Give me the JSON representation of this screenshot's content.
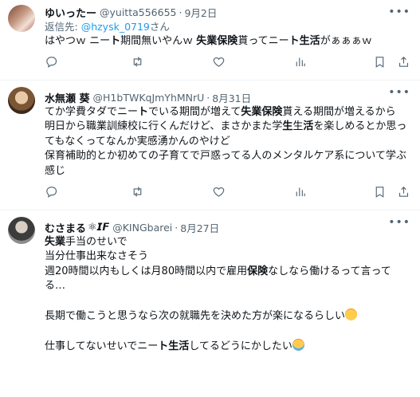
{
  "tweets": [
    {
      "name": "ゆいったー",
      "handle": "@yuitta556655",
      "dot": "·",
      "date": "9月2日",
      "reply_prefix": "返信先: ",
      "reply_to": "@hzysk_0719",
      "reply_suffix": "さん",
      "segments": [
        {
          "t": "はやつｗ ニー",
          "b": false
        },
        {
          "t": "ト",
          "b": true
        },
        {
          "t": "期間無いやんｗ ",
          "b": false
        },
        {
          "t": "失業保険",
          "b": true
        },
        {
          "t": "貰ってニー",
          "b": false
        },
        {
          "t": "ト生活",
          "b": true
        },
        {
          "t": "がぁぁぁｗ",
          "b": false
        }
      ]
    },
    {
      "name": "水無瀬 葵",
      "handle": "@H1bTWKqJmYhMNrU",
      "dot": "·",
      "date": "8月31日",
      "segments": [
        {
          "t": "てか学費タダでニー",
          "b": false
        },
        {
          "t": "ト",
          "b": true
        },
        {
          "t": "でいる期間が増えて",
          "b": false
        },
        {
          "t": "失業保険",
          "b": true
        },
        {
          "t": "貰える期間が増えるから\n明日から職業訓練校に行くんだけど、まさかまた学",
          "b": false
        },
        {
          "t": "生",
          "b": true
        },
        {
          "t": "生",
          "b": false
        },
        {
          "t": "活",
          "b": true
        },
        {
          "t": "を楽しめるとか思ってもなくってなんか実感湧かんのやけど\n保育補助的とか初めての子育てで戸惑ってる人のメンタルケア系について学ぶ感じ",
          "b": false
        }
      ]
    },
    {
      "name": "むさまる",
      "name_suffix": "⚛𝙄𝙁",
      "handle": "@KINGbarei",
      "dot": "·",
      "date": "8月27日",
      "segments": [
        {
          "t": "失業",
          "b": true
        },
        {
          "t": "手当のせいで\n当分仕事出来なさそう\n週20時間以内もしくは月80時間以内で雇用",
          "b": false
        },
        {
          "t": "保険",
          "b": true
        },
        {
          "t": "なしなら働けるって言ってる…\n\n長期で働こうと思うなら次の就職先を決めた方が楽になるらしい",
          "b": false
        },
        {
          "t": "__EMOJI_SWEAT__",
          "b": false
        },
        {
          "t": "\n\n仕事してないせいでニー",
          "b": false
        },
        {
          "t": "ト生活",
          "b": true
        },
        {
          "t": "してるどうにかしたい",
          "b": false
        },
        {
          "t": "__EMOJI_CRY__",
          "b": false
        }
      ]
    }
  ],
  "icons": {
    "more": "more-horizontal-icon",
    "reply": "reply-icon",
    "retweet": "retweet-icon",
    "like": "heart-icon",
    "views": "analytics-icon",
    "bookmark": "bookmark-icon",
    "share": "share-icon"
  }
}
